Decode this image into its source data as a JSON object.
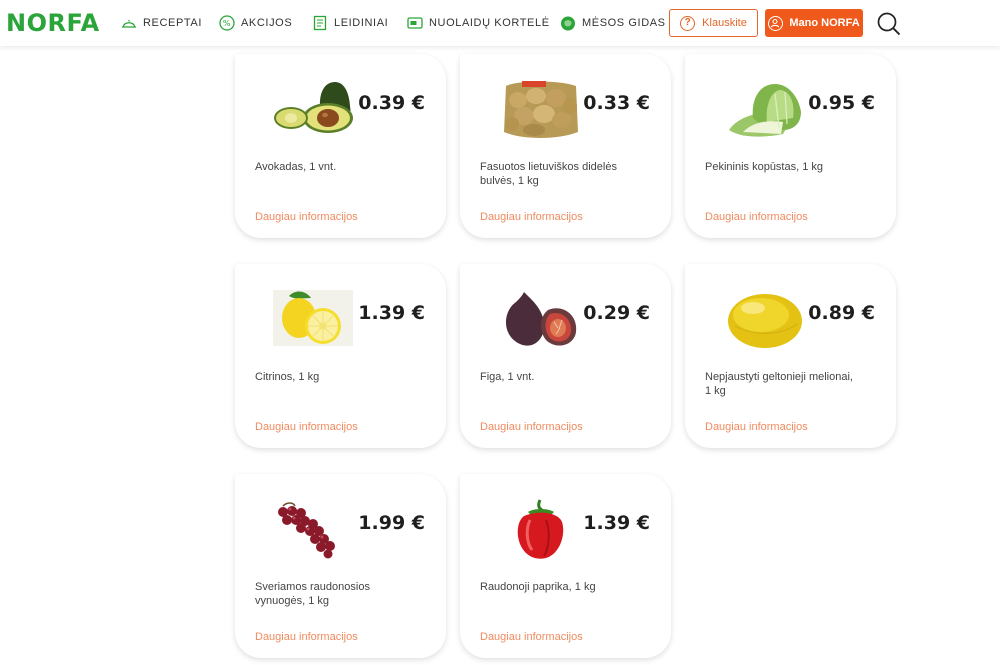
{
  "header": {
    "logo_text": "NORFA",
    "nav": [
      {
        "label": "RECEPTAI",
        "icon": "recipe-dish-icon"
      },
      {
        "label": "AKCIJOS",
        "icon": "percent-icon"
      },
      {
        "label": "LEIDINIAI",
        "icon": "leaflet-icon"
      },
      {
        "label": "NUOLAIDŲ KORTELĖ",
        "icon": "discount-card-icon"
      },
      {
        "label": "MĖSOS GIDAS",
        "icon": "meat-guide-icon"
      }
    ],
    "ask_label": "Klauskite",
    "account_label": "Mano NORFA",
    "colors": {
      "brand_green": "#2ba43a",
      "accent_orange": "#ef5a1c",
      "link_orange": "#ef8b5f"
    }
  },
  "products": [
    {
      "price": "0.39 €",
      "name": "Avokadas, 1 vnt.",
      "more": "Daugiau informacijos",
      "image": "avocado"
    },
    {
      "price": "0.33 €",
      "name": "Fasuotos lietuviškos didelės bulvės, 1 kg",
      "more": "Daugiau informacijos",
      "image": "potatoes-bag"
    },
    {
      "price": "0.95 €",
      "name": "Pekininis kopūstas, 1 kg",
      "more": "Daugiau informacijos",
      "image": "chinese-cabbage"
    },
    {
      "price": "1.39 €",
      "name": "Citrinos, 1 kg",
      "more": "Daugiau informacijos",
      "image": "lemons"
    },
    {
      "price": "0.29 €",
      "name": "Figa, 1 vnt.",
      "more": "Daugiau informacijos",
      "image": "figs"
    },
    {
      "price": "0.89 €",
      "name": "Nepjaustyti geltonieji melionai, 1 kg",
      "more": "Daugiau informacijos",
      "image": "yellow-melon"
    },
    {
      "price": "1.99 €",
      "name": "Sveriamos raudonosios vynuogės, 1 kg",
      "more": "Daugiau informacijos",
      "image": "red-grapes"
    },
    {
      "price": "1.39 €",
      "name": "Raudonoji paprika, 1 kg",
      "more": "Daugiau informacijos",
      "image": "red-pepper"
    }
  ]
}
